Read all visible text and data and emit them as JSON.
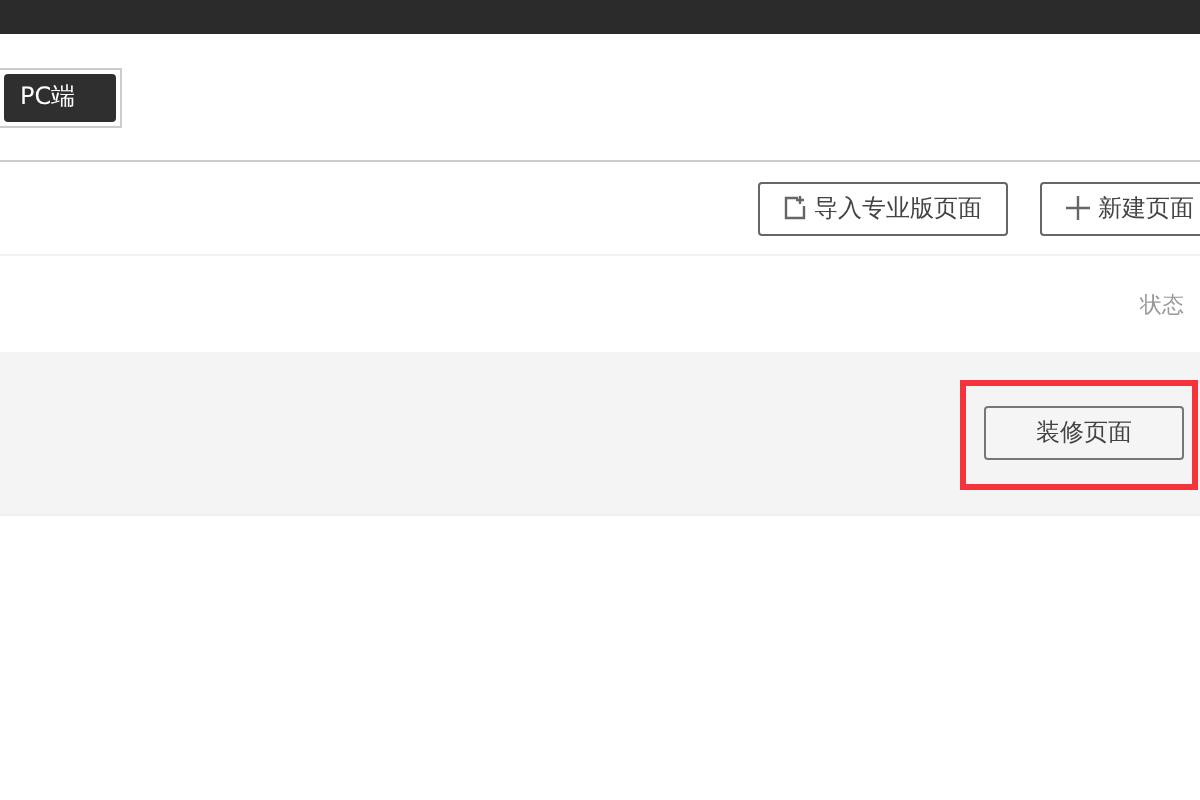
{
  "platform_tabs": [
    {
      "label": "PC端",
      "selected": true
    }
  ],
  "toolbar": {
    "buttons": [
      {
        "kind": "import",
        "label": "导入专业版页面"
      },
      {
        "kind": "new",
        "label": "新建页面"
      }
    ]
  },
  "table": {
    "columns": [
      {
        "label": "状态"
      }
    ],
    "rows": [
      {
        "action": "装修页面",
        "highlighted": true
      }
    ]
  }
}
